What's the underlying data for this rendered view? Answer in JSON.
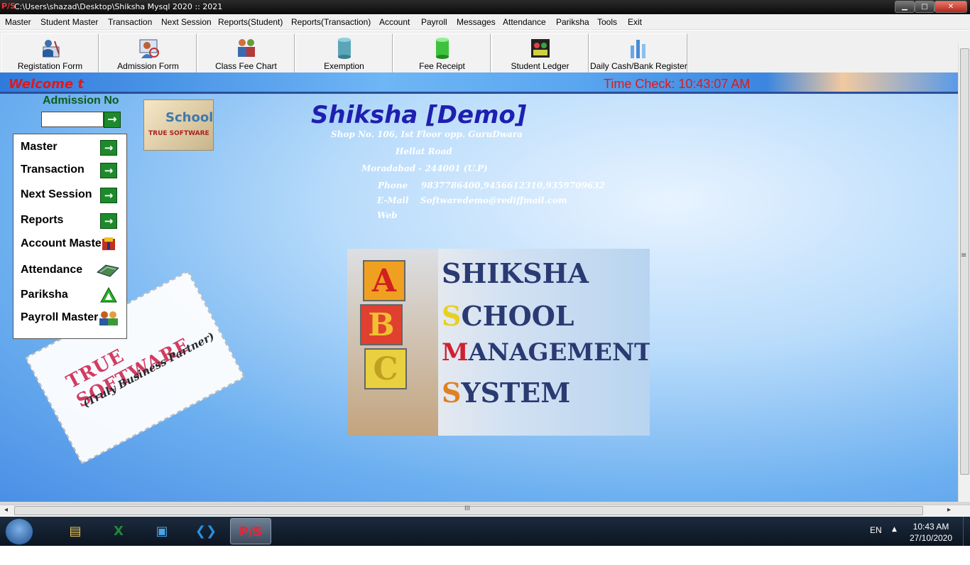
{
  "window": {
    "title": "C:\\Users\\shazad\\Desktop\\Shiksha Mysql 2020 :: 2021",
    "app_icon_text": "P/S",
    "controls": {
      "minimize": "▁",
      "maximize": "□",
      "close": "✕"
    }
  },
  "menu": [
    "Master",
    "Student Master",
    "Transaction",
    "Next Session",
    "Reports(Student)",
    "Reports(Transaction)",
    "Account",
    "Payroll",
    "Messages",
    "Attendance",
    "Pariksha",
    "Tools",
    "Exit"
  ],
  "toolbar": [
    {
      "label": "Registation Form",
      "icon": "registration-form-icon"
    },
    {
      "label": "Admission Form",
      "icon": "admission-form-icon"
    },
    {
      "label": "Class Fee Chart",
      "icon": "class-fee-chart-icon"
    },
    {
      "label": "Exemption",
      "icon": "cylinder-teal-icon"
    },
    {
      "label": "Fee Receipt",
      "icon": "cylinder-green-icon"
    },
    {
      "label": "Student Ledger",
      "icon": "student-ledger-icon"
    },
    {
      "label": "Daily Cash/Bank Register",
      "icon": "bar-chart-icon"
    }
  ],
  "header": {
    "welcome": "Welcome t",
    "time_check": "Time Check:  10:43:07 AM"
  },
  "admission": {
    "label": "Admission No",
    "value": "",
    "go_glyph": "→"
  },
  "small_logo": {
    "line1": "School",
    "line2": "TRUE SOFTWARE"
  },
  "nav": [
    {
      "label": "Master",
      "icon": "arrow-right-icon"
    },
    {
      "label": "Transaction",
      "icon": "arrow-right-icon"
    },
    {
      "label": "Next Session",
      "icon": "arrow-right-icon"
    },
    {
      "label": "Reports",
      "icon": "arrow-right-icon"
    },
    {
      "label": "Account Maste",
      "icon": "account-book-icon"
    },
    {
      "label": "Attendance",
      "icon": "attendance-icon"
    },
    {
      "label": "Pariksha",
      "icon": "triangle-icon"
    },
    {
      "label": "Payroll Master",
      "icon": "payroll-people-icon"
    }
  ],
  "company": {
    "name": "Shiksha [Demo]",
    "address1": "Shop No. 106, Ist Floor opp. GuruDwara",
    "address2": "Hellat Road",
    "address3": "Moradabad - 244001 (U.P)",
    "phone_label": "Phone",
    "phone": "9837786400,9456612310,9359709632",
    "email_label": "E-Mail",
    "email": "Softwaredemo@rediffmail.com",
    "web_label": "Web"
  },
  "big_logo": {
    "blocks": [
      "A",
      "B",
      "C"
    ],
    "lines": [
      {
        "initial": "",
        "rest": "SHIKSHA"
      },
      {
        "initial": "S",
        "rest": "CHOOL"
      },
      {
        "initial": "M",
        "rest": "ANAGEMENT"
      },
      {
        "initial": "S",
        "rest": "YSTEM"
      }
    ]
  },
  "stamp": {
    "line1": "TRUE SOFTWARE",
    "line2": "(Truly Business Partner)"
  },
  "scroll": {
    "grip": "III",
    "left": "◂",
    "right": "▸",
    "vgrip": "≡"
  },
  "taskbar": {
    "apps": [
      {
        "name": "file-explorer",
        "glyph": "📁",
        "color": "#e8c25a"
      },
      {
        "name": "excel",
        "glyph": "X",
        "color": "#1f8a3c"
      },
      {
        "name": "monitor-app",
        "glyph": "▣",
        "color": "#4aa3e8"
      },
      {
        "name": "vscode",
        "glyph": "❮❯",
        "color": "#2a8fe0"
      },
      {
        "name": "shiksha",
        "glyph": "P/S",
        "color": "#e23",
        "active": true
      }
    ],
    "lang": "EN",
    "tray_arrow": "▲",
    "time": "10:43 AM",
    "date": "27/10/2020"
  }
}
